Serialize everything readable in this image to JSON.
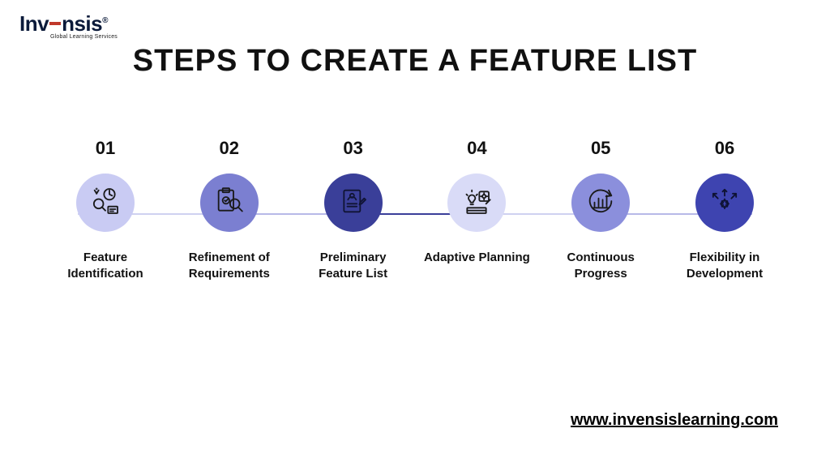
{
  "logo": {
    "brand": "InvΞnsis",
    "tagline": "Global Learning Services"
  },
  "title": "STEPS TO CREATE A FEATURE LIST",
  "colors": {
    "circle_bg": [
      "#c9cbf3",
      "#7b7fd1",
      "#3a3f99",
      "#d9dbf7",
      "#8b8fdc",
      "#3e44b0"
    ],
    "icon_stroke": [
      "#1a1a1a",
      "#1a1a1a",
      "#101434",
      "#1a1a1a",
      "#1a1a1a",
      "#0e1233"
    ],
    "line_seg": [
      "#cfd1f0",
      "#b7b9e8",
      "#3a3f99",
      "#cfd1f0",
      "#b7b9e8"
    ]
  },
  "steps": [
    {
      "num": "01",
      "label": "Feature Identification",
      "icon": "feature-identification-icon"
    },
    {
      "num": "02",
      "label": "Refinement of Requirements",
      "icon": "requirements-refinement-icon"
    },
    {
      "num": "03",
      "label": "Preliminary Feature List",
      "icon": "feature-list-icon"
    },
    {
      "num": "04",
      "label": "Adaptive Planning",
      "icon": "adaptive-planning-icon"
    },
    {
      "num": "05",
      "label": "Continuous Progress",
      "icon": "continuous-progress-icon"
    },
    {
      "num": "06",
      "label": "Flexibility in Development",
      "icon": "flexibility-icon"
    }
  ],
  "url": "www.invensislearning.com"
}
